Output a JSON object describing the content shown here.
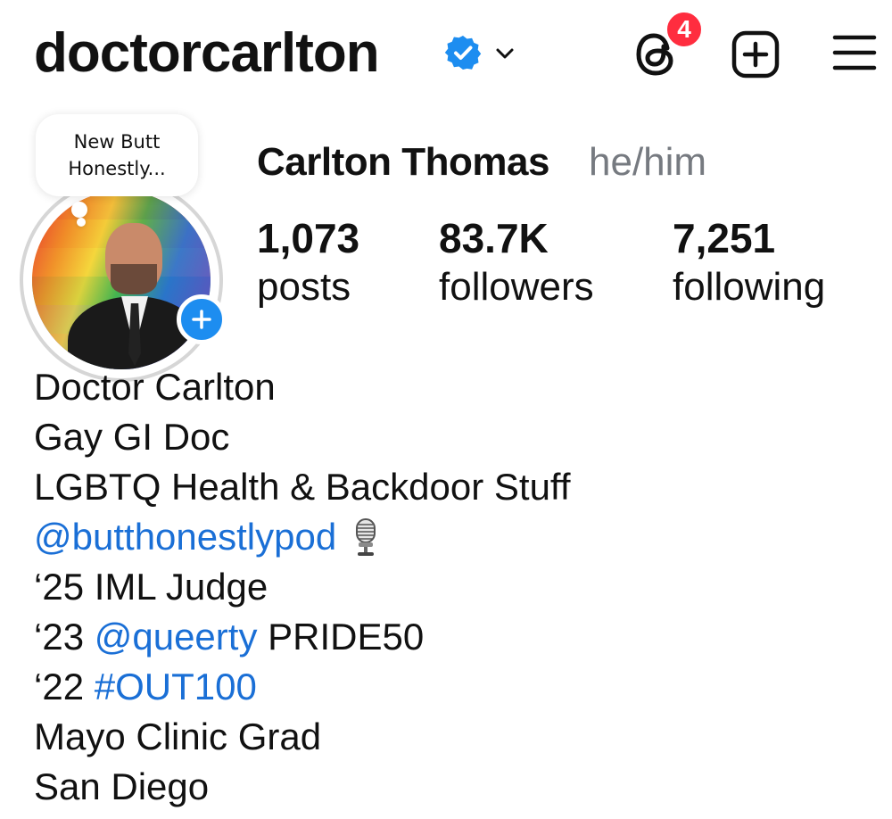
{
  "header": {
    "username": "doctorcarlton",
    "threads_badge_count": "4",
    "icons": {
      "verified": "verified-badge-icon",
      "chevron": "chevron-down-icon",
      "threads": "threads-icon",
      "create": "plus-square-icon",
      "menu": "hamburger-menu-icon"
    }
  },
  "profile": {
    "note": {
      "line1": "New Butt",
      "line2": "Honestly..."
    },
    "full_name": "Carlton Thomas",
    "pronouns": "he/him",
    "stats": [
      {
        "value": "1,073",
        "label": "posts"
      },
      {
        "value": "83.7K",
        "label": "followers"
      },
      {
        "value": "7,251",
        "label": "following"
      }
    ]
  },
  "bio": {
    "line1": "Doctor Carlton",
    "line2": "Gay GI Doc",
    "line3": "LGBTQ Health & Backdoor Stuff",
    "line4_link": "@butthonestlypod",
    "line5": "‘25 IML Judge",
    "line6_prefix": "‘23 ",
    "line6_link": "@queerty",
    "line6_suffix": " PRIDE50",
    "line7_prefix": "‘22 ",
    "line7_link": "#OUT100",
    "line8": "Mayo Clinic Grad",
    "line9": "San Diego"
  },
  "colors": {
    "link": "#1a6fd6",
    "verified": "#1d8df0",
    "badge": "#ff2d3f",
    "pronouns": "#767a80"
  }
}
